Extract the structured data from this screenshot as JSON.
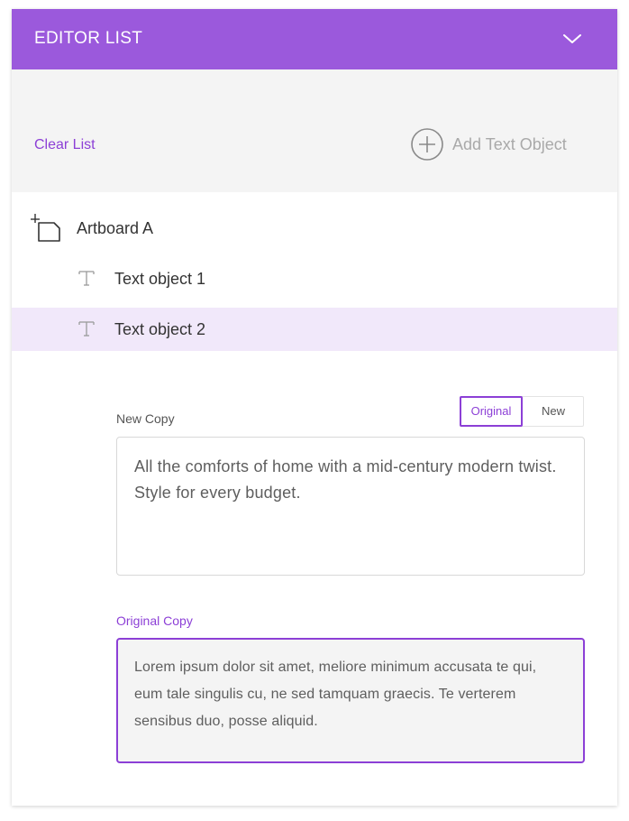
{
  "header": {
    "title": "EDITOR LIST",
    "chevron_icon": "chevron-down-icon"
  },
  "toolbar": {
    "clear_label": "Clear List",
    "add_label": "Add Text Object",
    "add_icon": "plus-circle-icon"
  },
  "tree": {
    "artboard": {
      "label": "Artboard A",
      "icon": "artboard-icon"
    },
    "items": [
      {
        "label": "Text object 1",
        "icon": "text-icon",
        "selected": false
      },
      {
        "label": "Text object 2",
        "icon": "text-icon",
        "selected": true
      }
    ]
  },
  "editor": {
    "new_copy_label": "New Copy",
    "toggle": {
      "original": "Original",
      "new": "New",
      "active": "Original"
    },
    "new_copy_text": "All the comforts of home with a mid-century modern twist.  Style for every budget.",
    "original_copy_label": "Original Copy",
    "original_copy_text": "Lorem ipsum dolor sit amet, meliore minimum accusata te qui, eum tale singulis cu, ne sed tamquam graecis. Te verterem sensibus duo, posse aliquid."
  },
  "colors": {
    "accent": "#9b59dc",
    "accent_text": "#8c3fd6",
    "selected_row": "#f1e8fa",
    "toolbar_bg": "#f4f4f4"
  }
}
